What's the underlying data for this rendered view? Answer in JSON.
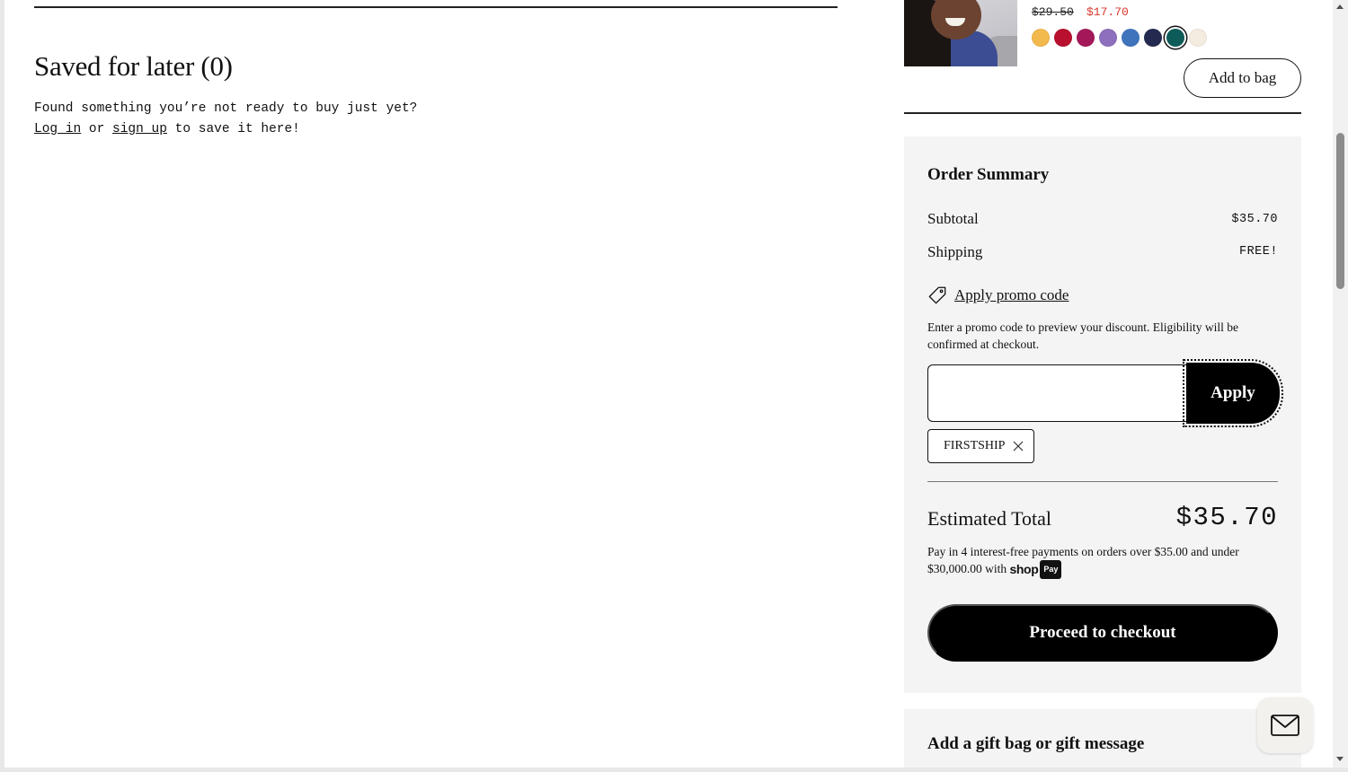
{
  "saved": {
    "title": "Saved for later (0)",
    "line1": "Found something you’re not ready to buy just yet?",
    "login_link": "Log in",
    "or_text": " or ",
    "signup_link": "sign up",
    "tail_text": " to save it here!"
  },
  "product": {
    "price_original": "$29.50",
    "price_sale": "$17.70",
    "swatches": [
      {
        "color": "#f2b94d"
      },
      {
        "color": "#b8102e"
      },
      {
        "color": "#a4185a"
      },
      {
        "color": "#8e6fbd"
      },
      {
        "color": "#3f74bd"
      },
      {
        "color": "#23294f"
      },
      {
        "color": "#0e5c5a",
        "selected": true
      },
      {
        "color": "#f4ece0"
      }
    ],
    "add_to_bag_label": "Add to bag"
  },
  "summary": {
    "title": "Order Summary",
    "subtotal_label": "Subtotal",
    "subtotal_value": "$35.70",
    "shipping_label": "Shipping",
    "shipping_value": "FREE!",
    "promo_link_label": "Apply promo code",
    "promo_help": "Enter a promo code to preview your discount. Eligibility will be confirmed at checkout.",
    "promo_input_value": "",
    "apply_label": "Apply",
    "applied_code": "FIRSTSHIP",
    "total_label": "Estimated Total",
    "total_value": "$35.70",
    "shoppay_text": "Pay in 4 interest-free payments on orders over $35.00 and under $30,000.00 with",
    "shoppay_brand": "shop",
    "shoppay_badge": "Pay",
    "checkout_label": "Proceed to checkout"
  },
  "gift": {
    "title": "Add a gift bag or gift message"
  },
  "colors": {
    "sale_price": "#d9352b",
    "panel_bg": "#f4f4f4",
    "button_bg": "#000000"
  },
  "icons": [
    "price-tag-icon",
    "close-icon",
    "mail-icon"
  ]
}
